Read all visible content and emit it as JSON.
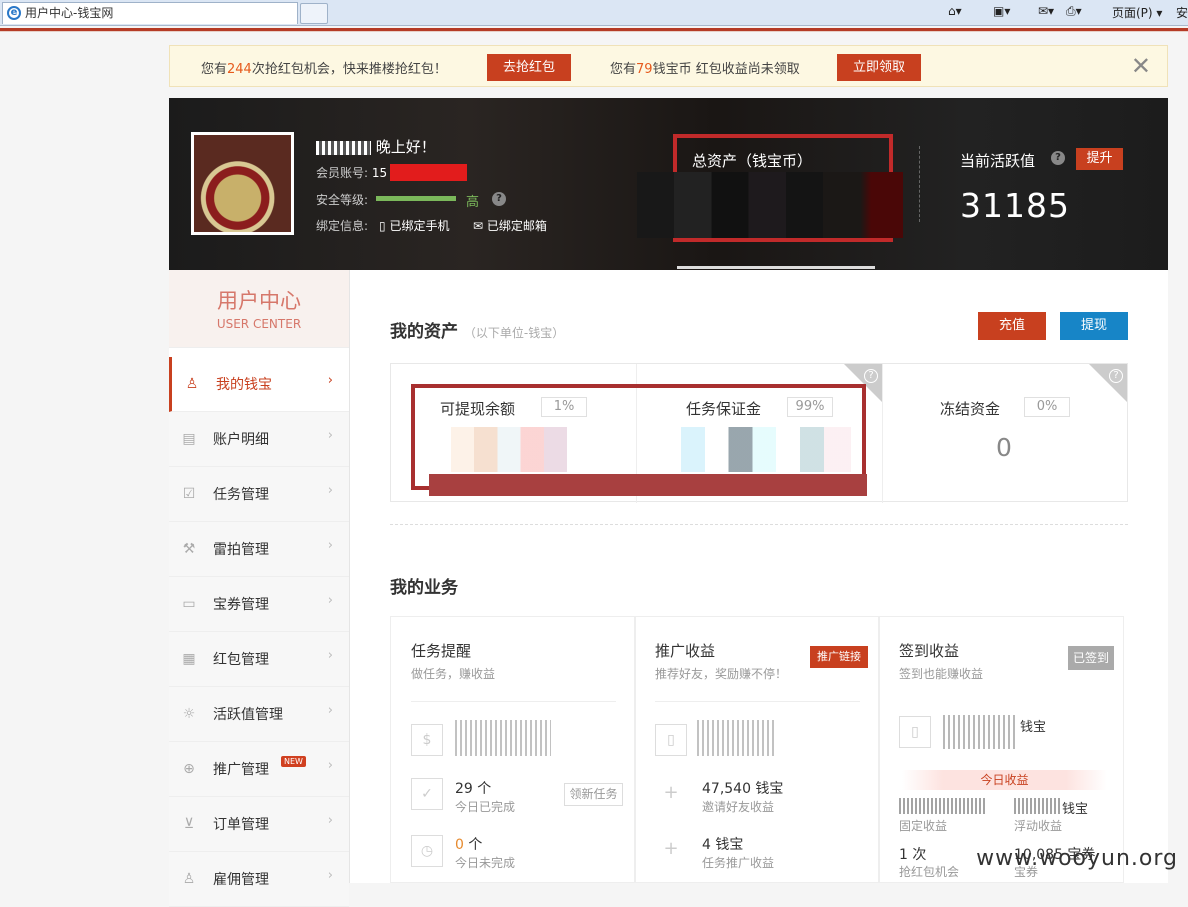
{
  "browser": {
    "tab_title": "用户中心-钱宝网",
    "page_menu": "页面(P)",
    "safety_menu": "安"
  },
  "notice": {
    "text1_prefix": "您有",
    "text1_count": "244",
    "text1_suffix": "次抢红包机会，快来推楼抢红包！",
    "btn1": "去抢红包",
    "text2_prefix": "您有",
    "text2_count": "79",
    "text2_suffix": "钱宝币 红包收益尚未领取",
    "btn2": "立即领取",
    "close": "✕"
  },
  "banner": {
    "greeting": "晚上好！",
    "account_label": "会员账号:",
    "account_value": "15",
    "security_label": "安全等级:",
    "security_level": "高",
    "bind_label": "绑定信息:",
    "bind_phone": "已绑定手机",
    "bind_email": "已绑定邮箱",
    "total_assets_label": "总资产（钱宝币）",
    "activity_label": "当前活跃值",
    "activity_upgrade": "提升",
    "activity_value": "31185"
  },
  "sidebar": {
    "title_cn": "用户中心",
    "title_en": "USER CENTER",
    "items": [
      {
        "label": "我的钱宝",
        "icon": "user-icon"
      },
      {
        "label": "账户明细",
        "icon": "ledger-icon"
      },
      {
        "label": "任务管理",
        "icon": "task-check-icon"
      },
      {
        "label": "雷拍管理",
        "icon": "gavel-icon"
      },
      {
        "label": "宝券管理",
        "icon": "coupon-icon"
      },
      {
        "label": "红包管理",
        "icon": "redpacket-icon"
      },
      {
        "label": "活跃值管理",
        "icon": "sun-icon"
      },
      {
        "label": "推广管理",
        "icon": "plus-circle-icon",
        "badge": "NEW"
      },
      {
        "label": "订单管理",
        "icon": "cart-icon"
      },
      {
        "label": "雇佣管理",
        "icon": "people-icon"
      }
    ]
  },
  "assets": {
    "title": "我的资产",
    "subtitle": "（以下单位-钱宝）",
    "recharge": "充值",
    "withdraw": "提现",
    "withdrawable_label": "可提现余额",
    "withdrawable_pct": "1%",
    "deposit_label": "任务保证金",
    "deposit_pct": "99%",
    "frozen_label": "冻结资金",
    "frozen_pct": "0%",
    "frozen_value": "0"
  },
  "business": {
    "title": "我的业务",
    "task": {
      "title": "任务提醒",
      "subtitle": "做任务，赚收益",
      "completed_value": "29 个",
      "completed_label": "今日已完成",
      "new_task_btn": "领新任务",
      "pending_value": "0",
      "pending_unit": " 个",
      "pending_label": "今日未完成"
    },
    "promo": {
      "title": "推广收益",
      "subtitle": "推荐好友，奖励赚不停！",
      "link_btn": "推广链接",
      "invite_value": "47,540 钱宝",
      "invite_label": "邀请好友收益",
      "task_value": "4 钱宝",
      "task_label": "任务推广收益"
    },
    "signin": {
      "title": "签到收益",
      "subtitle": "签到也能赚收益",
      "signed_btn": "已签到",
      "unit": "钱宝",
      "today_label": "今日收益",
      "fixed_label": "固定收益",
      "float_unit": "钱宝",
      "float_label": "浮动收益",
      "chances_value": "1 次",
      "chances_label": "抢红包机会",
      "coupon_value": "10,085 宝券",
      "coupon_label": "宝券"
    }
  },
  "watermark": "www.wooyun.org",
  "colors": {
    "brand_red": "#c8401f",
    "blue": "#1785c7",
    "notice_bg": "#fdf8e2"
  }
}
